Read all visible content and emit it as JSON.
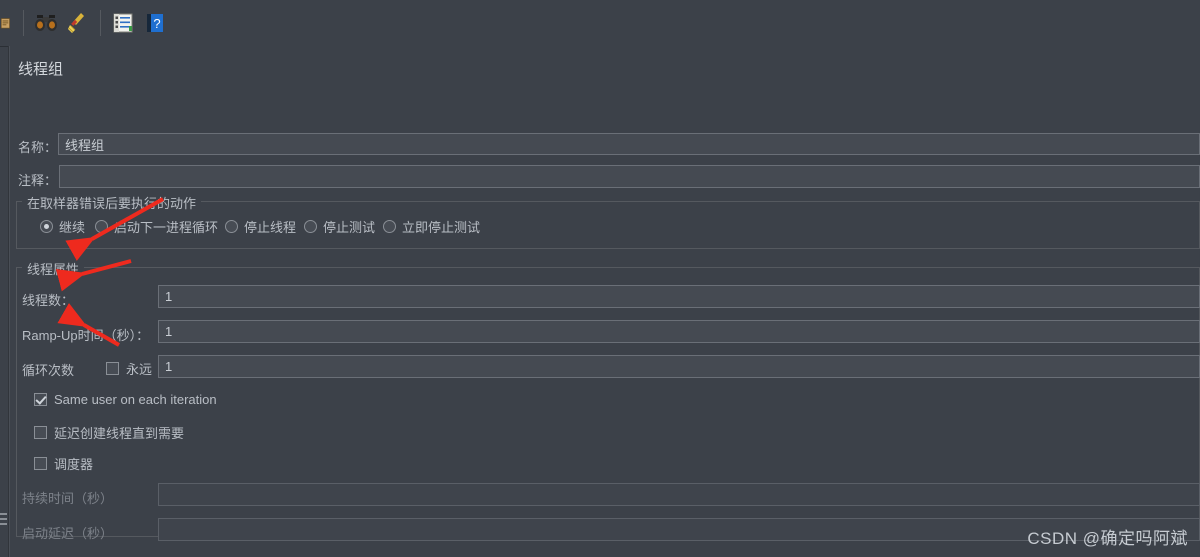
{
  "toolbar": {
    "icons": [
      {
        "name": "clipboard-partial-icon",
        "glyph": "🗒"
      },
      {
        "name": "binoculars-search-icon",
        "glyph": "🔭"
      },
      {
        "name": "broom-clear-icon",
        "glyph": "🧹"
      },
      {
        "name": "notepad-templates-icon",
        "glyph": "📝"
      },
      {
        "name": "help-book-icon",
        "glyph": "📘"
      }
    ]
  },
  "panel": {
    "title": "线程组",
    "name_label": "名称：",
    "name_value": "线程组",
    "comment_label": "注释：",
    "comment_value": "",
    "error_action": {
      "group_title": "在取样器错误后要执行的动作",
      "options": [
        {
          "label": "继续",
          "selected": true
        },
        {
          "label": "启动下一进程循环",
          "selected": false
        },
        {
          "label": "停止线程",
          "selected": false
        },
        {
          "label": "停止测试",
          "selected": false
        },
        {
          "label": "立即停止测试",
          "selected": false
        }
      ]
    },
    "thread_props": {
      "group_title": "线程属性",
      "threads_label": "线程数：",
      "threads_value": "1",
      "rampup_label": "Ramp-Up时间（秒）：",
      "rampup_value": "1",
      "loops_label": "循环次数",
      "forever_label": "永远",
      "forever_checked": false,
      "loops_value": "1",
      "same_user_label": "Same user on each iteration",
      "same_user_checked": true,
      "delay_create_label": "延迟创建线程直到需要",
      "delay_create_checked": false,
      "scheduler_label": "调度器",
      "scheduler_checked": false,
      "duration_label": "持续时间（秒）",
      "duration_value": "",
      "startup_delay_label": "启动延迟（秒）",
      "startup_delay_value": ""
    }
  },
  "watermark": "CSDN @确定吗阿斌",
  "colors": {
    "background": "#3c4149",
    "field_bg": "#454a52",
    "border": "#6a6f77",
    "text": "#b9bec5",
    "annotation_red": "#ee2a1e"
  }
}
